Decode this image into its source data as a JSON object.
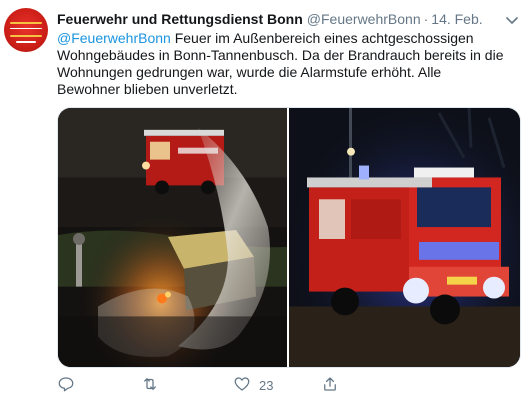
{
  "tweet": {
    "author_name": "Feuerwehr und Rettungsdienst Bonn",
    "handle": "@FeuerwehrBonn",
    "separator": "·",
    "date": "14. Feb.",
    "mention": "@FeuerwehrBonn",
    "body": " Feuer im Außenbereich eines achtgeschossigen Wohngebäudes in Bonn-Tannenbusch. Da der Brandrauch bereits in die Wohnungen gedrungen war, wurde die Alarmstufe erhöht. Alle Bewohner blieben unverletzt.",
    "avatar_text": "Feuerwehr und Rettungsdienst Bonn",
    "media": [
      {
        "kind": "photo",
        "subject": "fire-scene"
      },
      {
        "kind": "photo",
        "subject": "fire-engine-night"
      }
    ],
    "actions": {
      "reply_icon": "reply-icon",
      "retweet_icon": "retweet-icon",
      "like_icon": "heart-icon",
      "like_count": "23",
      "share_icon": "share-icon"
    },
    "colors": {
      "link": "#1b95e0",
      "secondary_text": "#657786",
      "primary_text": "#14171a",
      "avatar_red": "#cc1f18"
    }
  }
}
